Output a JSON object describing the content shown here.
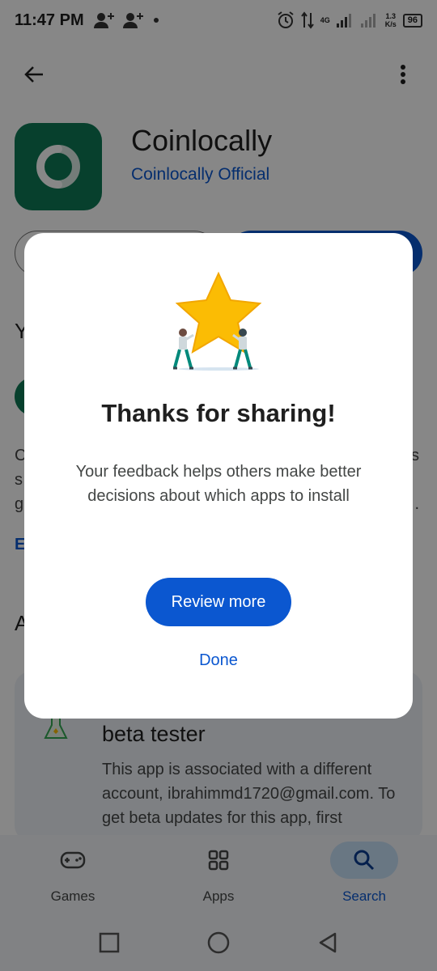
{
  "status_bar": {
    "time": "11:47 PM",
    "network_label": "4G",
    "speed_value": "1.3",
    "speed_unit": "K/s",
    "battery": "96"
  },
  "app": {
    "name": "Coinlocally",
    "developer": "Coinlocally Official",
    "icon_color": "#0e7a55"
  },
  "partial_texts": {
    "section_your": "Y",
    "desc_line1": "C",
    "desc_line2": "s",
    "desc_line3": "g",
    "link_letter": "E",
    "section_about": "A",
    "right_s": "s",
    "right_dot": "."
  },
  "beta_card": {
    "title": "beta tester",
    "body": "This app is associated with a different account, ibrahimmd1720@gmail.com. To get beta updates for this app, first"
  },
  "bottom_nav": {
    "items": [
      {
        "label": "Games",
        "icon": "gamepad-icon"
      },
      {
        "label": "Apps",
        "icon": "apps-grid-icon"
      },
      {
        "label": "Search",
        "icon": "search-icon",
        "active": true
      }
    ]
  },
  "dialog": {
    "title": "Thanks for sharing!",
    "body": "Your feedback helps others make better decisions about which apps to install",
    "primary_button": "Review more",
    "secondary_button": "Done"
  },
  "colors": {
    "accent": "#0b57d0",
    "star": "#fbbc04",
    "scrim": "rgba(0,0,0,0.47)"
  }
}
